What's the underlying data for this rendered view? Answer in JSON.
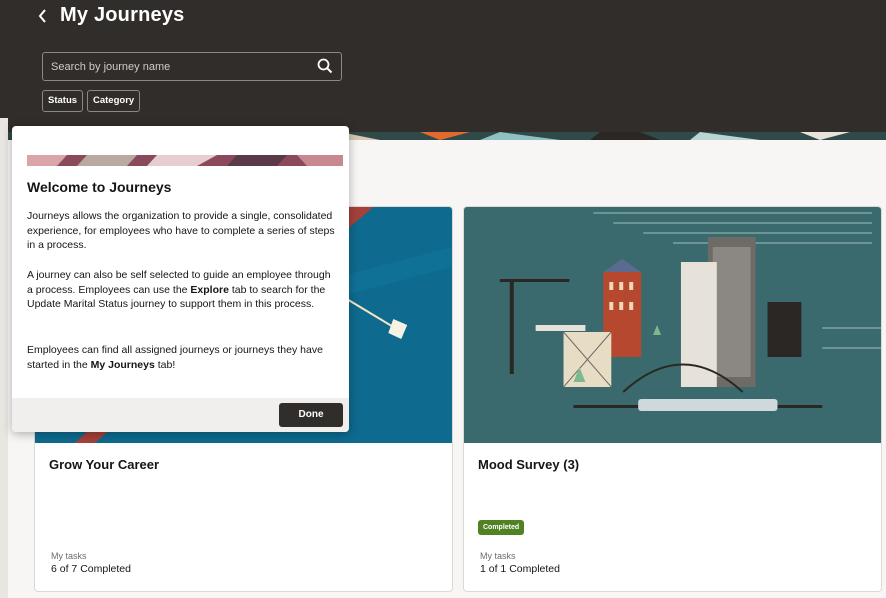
{
  "header": {
    "back_icon": "chevron-left-icon",
    "title": "My Journeys",
    "search_placeholder": "Search by journey name",
    "search_icon": "search-icon",
    "filters": [
      "Status",
      "Category"
    ]
  },
  "cards": [
    {
      "title": "Grow Your Career",
      "badge": "",
      "tasks_label": "My tasks",
      "tasks_value": "6 of 7 Completed",
      "image_color": "#0e6a8f"
    },
    {
      "title": "Mood Survey (3)",
      "badge": "Completed",
      "tasks_label": "My tasks",
      "tasks_value": "1 of 1 Completed",
      "image_color": "#3a6a6e"
    }
  ],
  "popup": {
    "title": "Welcome to Journeys",
    "p1": "Journeys allows the organization to provide a single, consolidated experience, for employees who have to complete a series of steps in a process.",
    "p2_a": "A journey can also be self selected to guide an employee through a process. Employees can use the ",
    "p2_bold": "Explore",
    "p2_b": " tab to search for the Update Marital Status journey to support them in this process.",
    "p3_a": "Employees can find all assigned journeys or journeys they have started in the ",
    "p3_bold": "My Journeys",
    "p3_b": " tab!",
    "done_label": "Done"
  },
  "colors": {
    "header_bg": "#312d2a",
    "badge_green": "#508223",
    "done_button": "#312d2a"
  }
}
